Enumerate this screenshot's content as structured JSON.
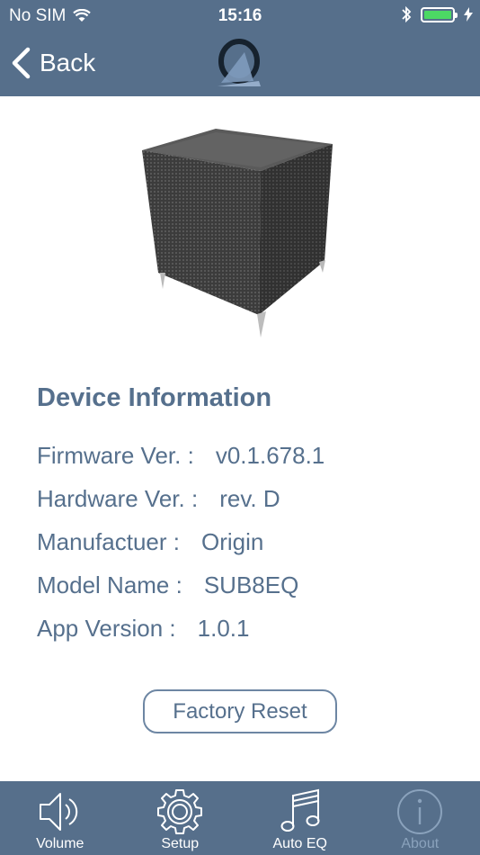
{
  "status": {
    "carrier": "No SIM",
    "time": "15:16",
    "battery_level": 1.0
  },
  "nav": {
    "back_label": "Back"
  },
  "colors": {
    "accent": "#566f8b",
    "text": "#56708d",
    "battery": "#4cd964",
    "inactive_tab": "#8aa2bc"
  },
  "device_info": {
    "title": "Device Information",
    "rows": [
      {
        "label": "Firmware Ver. :",
        "value": "v0.1.678.1"
      },
      {
        "label": "Hardware Ver. :",
        "value": "rev. D"
      },
      {
        "label": "Manufactuer :",
        "value": "Origin"
      },
      {
        "label": "Model Name :",
        "value": "SUB8EQ"
      },
      {
        "label": "App Version :",
        "value": "1.0.1"
      }
    ]
  },
  "actions": {
    "factory_reset_label": "Factory Reset"
  },
  "tabs": [
    {
      "label": "Volume",
      "icon": "speaker-icon"
    },
    {
      "label": "Setup",
      "icon": "gear-icon"
    },
    {
      "label": "Auto EQ",
      "icon": "music-note-icon"
    },
    {
      "label": "About",
      "icon": "info-icon",
      "selected": true
    }
  ]
}
